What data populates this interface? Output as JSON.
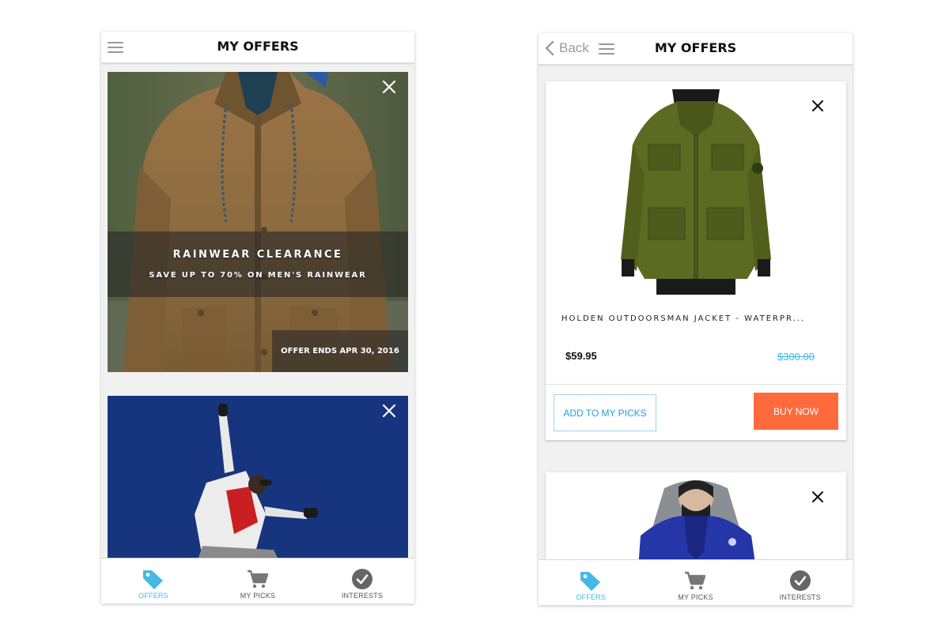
{
  "left_screen": {
    "header": {
      "title": "MY OFFERS",
      "menu_icon": "hamburger-icon"
    },
    "offers": [
      {
        "title": "RAINWEAR CLEARANCE",
        "subtitle": "SAVE UP TO 70% ON MEN'S RAINWEAR",
        "ends": "OFFER ENDS APR 30, 2016",
        "image": "man-in-brown-rain-jacket-photo",
        "close_icon": "close-icon"
      },
      {
        "image": "skier-jumping-against-blue-sky-photo",
        "close_icon": "close-icon"
      }
    ]
  },
  "right_screen": {
    "header": {
      "back_label": "Back",
      "title": "MY OFFERS",
      "menu_icon": "hamburger-icon",
      "back_icon": "chevron-left-icon"
    },
    "products": [
      {
        "name": "HOLDEN OUTDOORSMAN JACKET - WATERPR...",
        "price": "$59.95",
        "original_price": "$300.00",
        "add_label": "ADD TO MY PICKS",
        "buy_label": "BUY NOW",
        "image": "olive-green-jacket-photo"
      },
      {
        "image": "blue-shell-jacket-photo"
      }
    ]
  },
  "tabbar": {
    "tabs": [
      {
        "label": "OFFERS",
        "icon": "tag-icon",
        "active": true
      },
      {
        "label": "MY PICKS",
        "icon": "cart-icon",
        "active": false
      },
      {
        "label": "INTERESTS",
        "icon": "check-circle-icon",
        "active": false
      }
    ]
  },
  "colors": {
    "accent": "#45b8e6",
    "buy_button": "#ff6a3d",
    "ski_sky": "#17357e"
  }
}
